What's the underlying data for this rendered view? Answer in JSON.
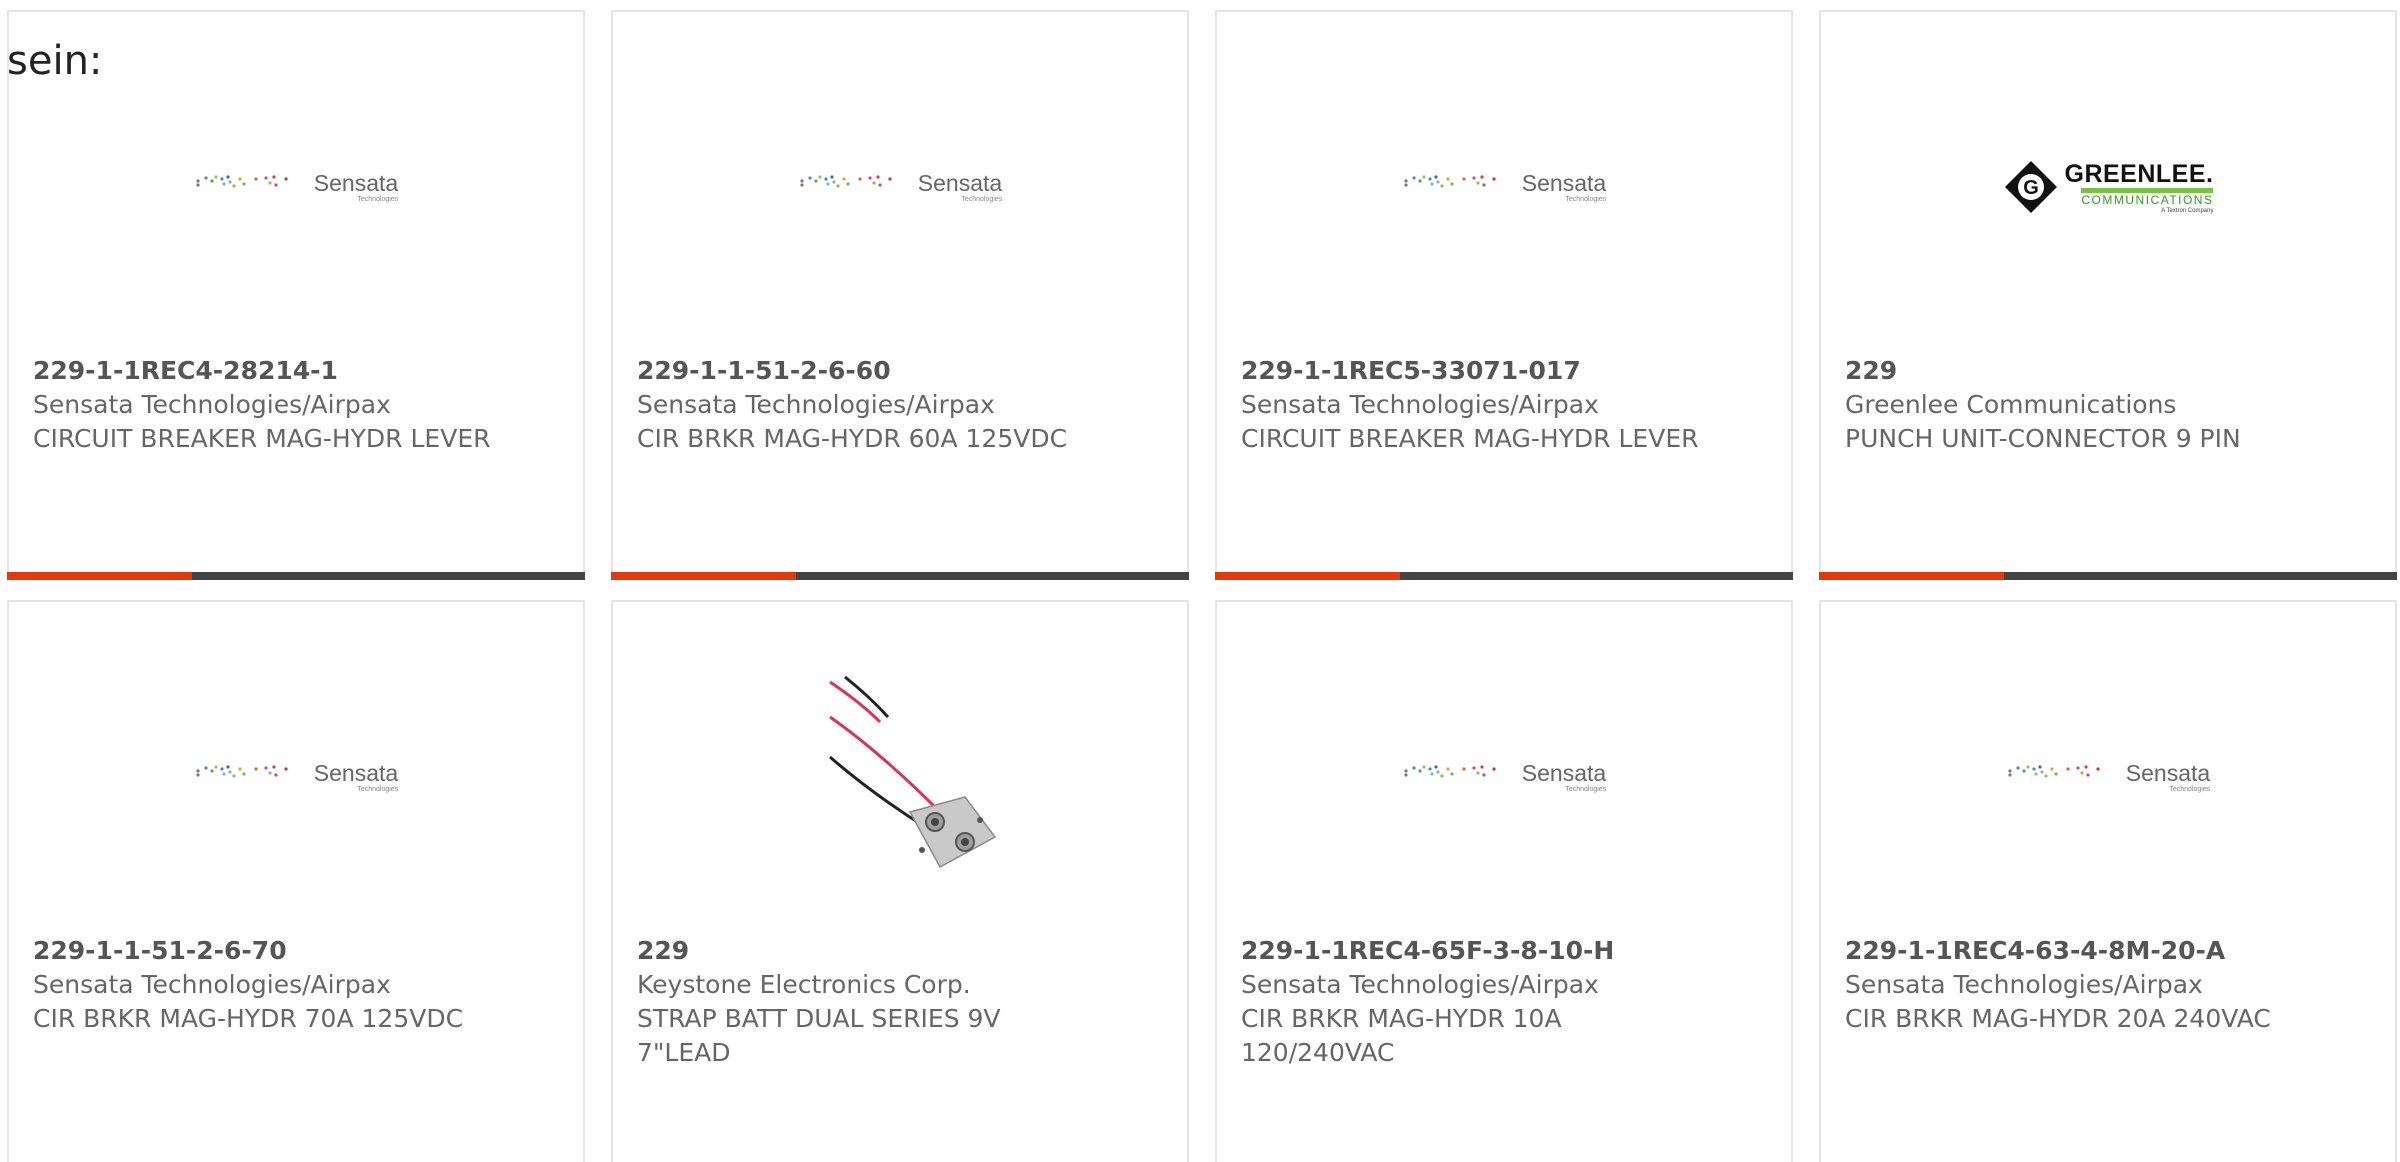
{
  "intro_text": "sein:",
  "colors": {
    "accent": "#e23a0d",
    "bar": "#444444",
    "text": "#666666",
    "border": "#e5e5e5"
  },
  "logos": {
    "sensata_name": "Sensata",
    "sensata_sub": "Technologies",
    "greenlee_name": "GREENLEE.",
    "greenlee_comm": "COMMUNICATIONS",
    "greenlee_textron": "A Textron Company",
    "greenlee_mark_letter": "G"
  },
  "products": [
    {
      "part": "229-1-1REC4-28214-1",
      "mfr": "Sensata Technologies/Airpax",
      "desc": "CIRCUIT BREAKER MAG-HYDR LEVER",
      "image": "sensata-logo"
    },
    {
      "part": "229-1-1-51-2-6-60",
      "mfr": "Sensata Technologies/Airpax",
      "desc": "CIR BRKR MAG-HYDR 60A 125VDC",
      "image": "sensata-logo"
    },
    {
      "part": "229-1-1REC5-33071-017",
      "mfr": "Sensata Technologies/Airpax",
      "desc": "CIRCUIT BREAKER MAG-HYDR LEVER",
      "image": "sensata-logo"
    },
    {
      "part": "229",
      "mfr": "Greenlee Communications",
      "desc": "PUNCH UNIT-CONNECTOR 9 PIN",
      "image": "greenlee-logo"
    },
    {
      "part": "229-1-1-51-2-6-70",
      "mfr": "Sensata Technologies/Airpax",
      "desc": "CIR BRKR MAG-HYDR 70A 125VDC",
      "image": "sensata-logo"
    },
    {
      "part": "229",
      "mfr": "Keystone Electronics Corp.",
      "desc": "STRAP BATT DUAL SERIES 9V 7\"LEAD",
      "image": "battery-strap-photo"
    },
    {
      "part": "229-1-1REC4-65F-3-8-10-H",
      "mfr": "Sensata Technologies/Airpax",
      "desc": "CIR BRKR MAG-HYDR 10A 120/240VAC",
      "image": "sensata-logo"
    },
    {
      "part": "229-1-1REC4-63-4-8M-20-A",
      "mfr": "Sensata Technologies/Airpax",
      "desc": "CIR BRKR MAG-HYDR 20A 240VAC",
      "image": "sensata-logo"
    }
  ]
}
